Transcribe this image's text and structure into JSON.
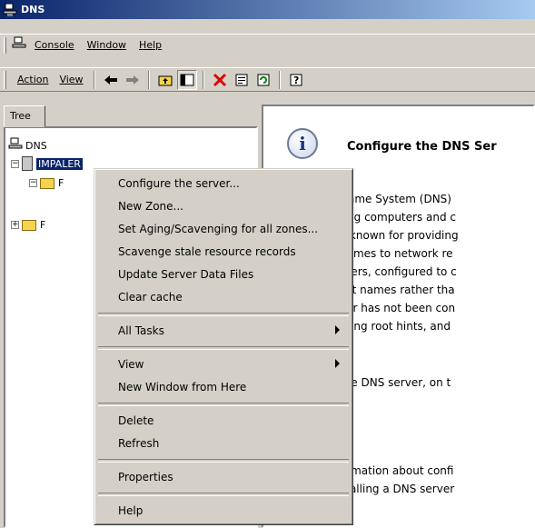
{
  "window": {
    "title": "DNS"
  },
  "menubar": {
    "items": [
      "Console",
      "Window",
      "Help"
    ]
  },
  "toolbar": {
    "action_label": "Action",
    "view_label": "View"
  },
  "tree": {
    "tab_label": "Tree",
    "root_label": "DNS",
    "server_label": "IMPALER",
    "child1_label": "F",
    "child2_label": "F"
  },
  "content": {
    "heading": "Configure the DNS Ser",
    "lines": [
      "Name System (DNS)",
      "ting computers and c",
      "y known for providing",
      "names to network re",
      "uters, configured to c",
      "ost names rather tha",
      "ver has not been con",
      "ating root hints, and",
      ".",
      "the DNS server, on t",
      "ormation about confi",
      "stalling a DNS server"
    ]
  },
  "context_menu": {
    "group1": [
      "Configure the server...",
      "New Zone...",
      "Set Aging/Scavenging for all zones...",
      "Scavenge stale resource records",
      "Update Server Data Files",
      "Clear cache"
    ],
    "all_tasks": "All Tasks",
    "view": "View",
    "new_window": "New Window from Here",
    "delete": "Delete",
    "refresh": "Refresh",
    "properties": "Properties",
    "help": "Help"
  },
  "colors": {
    "title_gradient_start": "#0a246a",
    "selection": "#0a246a",
    "face": "#d4d0c8"
  },
  "icons": [
    "dns-icon",
    "back-arrow-icon",
    "forward-arrow-icon",
    "up-folder-icon",
    "show-hide-tree-icon",
    "delete-icon",
    "properties-icon",
    "refresh-icon",
    "help-icon",
    "info-icon"
  ]
}
